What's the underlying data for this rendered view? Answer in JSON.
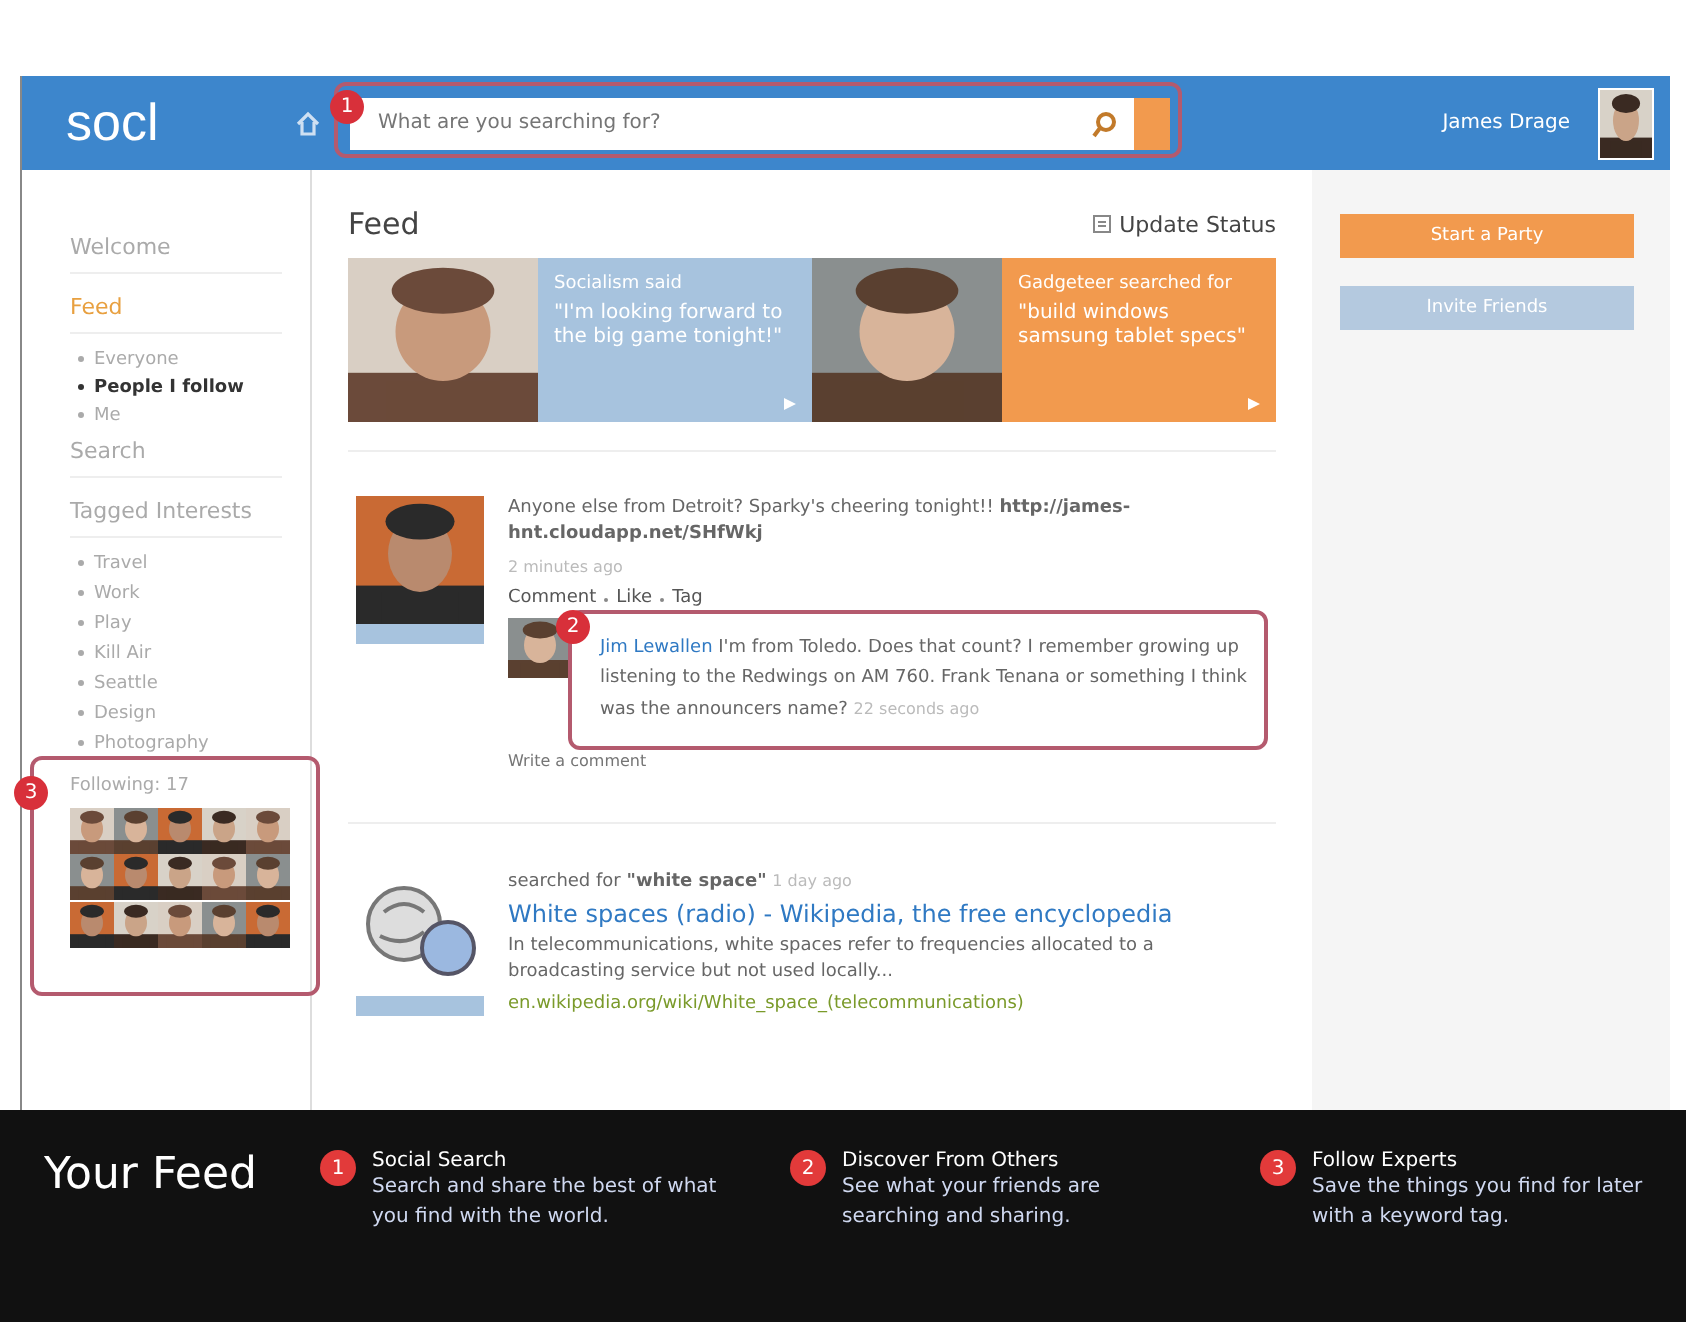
{
  "header": {
    "logo": "socl",
    "search_placeholder": "What are you searching for?",
    "user_name": "James Drage",
    "marker": "1"
  },
  "sidebar": {
    "welcome": "Welcome",
    "feed": {
      "label": "Feed",
      "items": [
        {
          "label": "Everyone",
          "selected": false
        },
        {
          "label": "People I follow",
          "selected": true
        },
        {
          "label": "Me",
          "selected": false
        }
      ]
    },
    "search": "Search",
    "tagged": {
      "label": "Tagged Interests",
      "items": [
        "Travel",
        "Work",
        "Play",
        "Kill Air",
        "Seattle",
        "Design",
        "Photography"
      ]
    },
    "following": {
      "label": "Following: 17",
      "marker": "3"
    }
  },
  "feed": {
    "title": "Feed",
    "update_status": "Update Status",
    "highlights": [
      {
        "caption": "Socialism said",
        "quote": "\"I'm looking forward to the big game tonight!\"",
        "color": "#a7c3de"
      },
      {
        "caption": "Gadgeteer searched for",
        "quote": "\"build windows samsung tablet specs\"",
        "color": "#f29a4e"
      }
    ],
    "posts": [
      {
        "kind": "status",
        "text": "Anyone else from Detroit? Sparky's cheering tonight!! **http://james-hnt.cloudapp.net/SHfWkj**",
        "time": "2 minutes ago",
        "actions": [
          "Comment",
          "Like",
          "Tag"
        ],
        "comment": {
          "author": "Jim Lewallen",
          "text": "I'm from Toledo. Does that count? I remember growing up listening to the Redwings on AM 760. Frank Tenana or something I think was the announcers name?",
          "time": "22 seconds ago",
          "marker": "2"
        },
        "reply_placeholder": "Write a comment"
      },
      {
        "kind": "search",
        "searched": "searched for **\"white space\"**",
        "time": "1 day ago",
        "link": "White spaces (radio) - Wikipedia, the free encyclopedia",
        "snippet": "In telecommunications, white spaces refer to frequencies allocated to a broadcasting service but not used locally...",
        "url": "en.wikipedia.org/wiki/White_space_(telecommunications)"
      }
    ]
  },
  "actions": [
    {
      "label": "Start a Party",
      "kind": "primary"
    },
    {
      "label": "Invite Friends",
      "kind": "secondary"
    }
  ],
  "footer": {
    "title": "Your Feed",
    "callouts": [
      {
        "number": "1",
        "title": "Social Search",
        "text": "Search and share the best of what you find with the world."
      },
      {
        "number": "2",
        "title": "Discover From Others",
        "text": "See what your friends are searching and sharing."
      },
      {
        "number": "3",
        "title": "Follow Experts",
        "text": "Save the things you find for later with a keyword tag."
      }
    ]
  }
}
